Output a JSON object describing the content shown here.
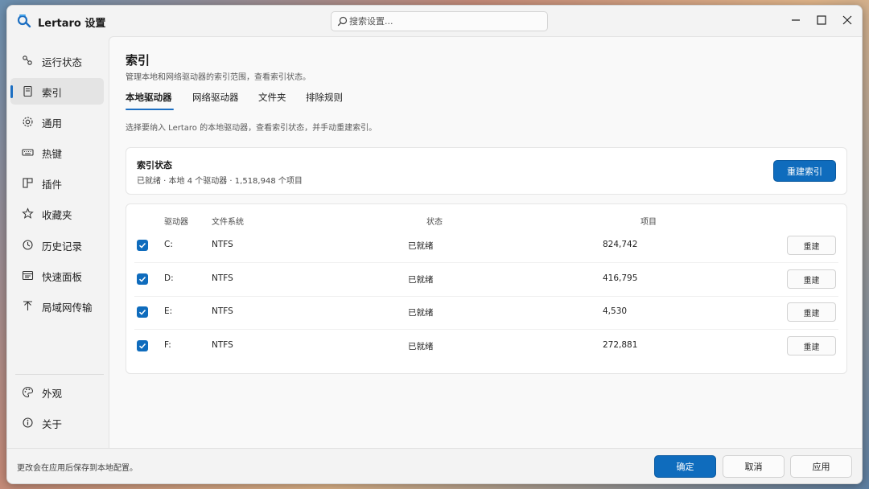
{
  "app": {
    "title": "Lertaro 设置",
    "logo_icon": "lertaro-logo-icon"
  },
  "search": {
    "placeholder": "搜索设置..."
  },
  "window_controls": [
    "minimize-icon",
    "maximize-icon",
    "close-icon"
  ],
  "sidebar": {
    "items": [
      {
        "label": "运行状态",
        "icon": "status-icon",
        "active": false
      },
      {
        "label": "索引",
        "icon": "index-icon",
        "active": true
      },
      {
        "label": "通用",
        "icon": "gear-icon",
        "active": false
      },
      {
        "label": "热键",
        "icon": "keyboard-icon",
        "active": false
      },
      {
        "label": "插件",
        "icon": "plugin-icon",
        "active": false
      },
      {
        "label": "收藏夹",
        "icon": "star-icon",
        "active": false
      },
      {
        "label": "历史记录",
        "icon": "history-icon",
        "active": false
      },
      {
        "label": "快速面板",
        "icon": "panel-icon",
        "active": false
      },
      {
        "label": "局域网传输",
        "icon": "transfer-icon",
        "active": false
      }
    ],
    "bottom_items": [
      {
        "label": "外观",
        "icon": "palette-icon"
      },
      {
        "label": "关于",
        "icon": "info-icon"
      }
    ]
  },
  "main": {
    "title": "索引",
    "subtitle": "管理本地和网络驱动器的索引范围，查看索引状态。",
    "tabs": [
      {
        "label": "本地驱动器",
        "active": true
      },
      {
        "label": "网络驱动器",
        "active": false
      },
      {
        "label": "文件夹",
        "active": false
      },
      {
        "label": "排除规则",
        "active": false
      }
    ],
    "tab_description": "选择要纳入 Lertaro 的本地驱动器，查看索引状态，并手动重建索引。",
    "status_card": {
      "title": "索引状态",
      "detail": "已就绪 · 本地 4 个驱动器 · 1,518,948 个项目",
      "rebuild_button": "重建索引"
    },
    "drive_table": {
      "columns": [
        "驱动器",
        "文件系统",
        "状态",
        "项目"
      ],
      "rows": [
        {
          "checked": true,
          "drive": "C:",
          "fs": "NTFS",
          "status": "已就绪",
          "items": "824,742",
          "action": "重建"
        },
        {
          "checked": true,
          "drive": "D:",
          "fs": "NTFS",
          "status": "已就绪",
          "items": "416,795",
          "action": "重建"
        },
        {
          "checked": true,
          "drive": "E:",
          "fs": "NTFS",
          "status": "已就绪",
          "items": "4,530",
          "action": "重建"
        },
        {
          "checked": true,
          "drive": "F:",
          "fs": "NTFS",
          "status": "已就绪",
          "items": "272,881",
          "action": "重建"
        }
      ]
    }
  },
  "footer": {
    "note": "更改会在应用后保存到本地配置。",
    "ok": "确定",
    "cancel": "取消",
    "apply": "应用"
  },
  "colors": {
    "accent": "#0f6cbd",
    "window_bg": "#f3f3f3",
    "card_bg": "#ffffff"
  }
}
